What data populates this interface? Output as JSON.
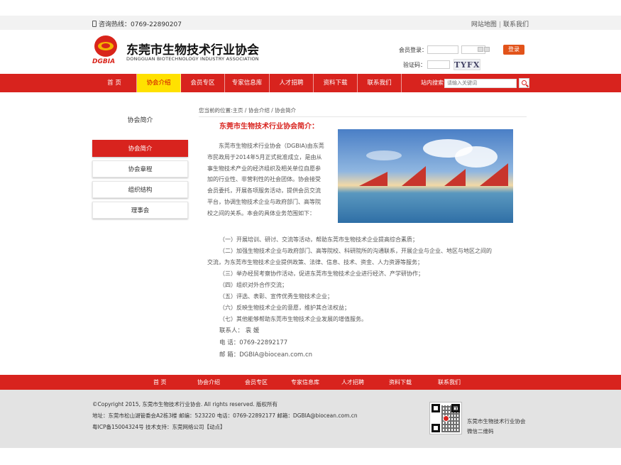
{
  "topbar": {
    "hotline": "咨询热线：0769-22890207",
    "links": [
      "网站地图",
      "联系我们"
    ]
  },
  "header": {
    "logo_mark": "DGBIA",
    "title": "东莞市生物技术行业协会",
    "subtitle": "DONGGUAN BIOTECHNOLOGY INDUSTRY ASSOCIATION"
  },
  "login": {
    "member_label": "会员登录：",
    "button": "登录",
    "code_label": "验证码：",
    "captcha": "TYFX"
  },
  "nav": {
    "items": [
      "首 页",
      "协会介绍",
      "会员专区",
      "专家信息库",
      "人才招聘",
      "资料下载",
      "联系我们"
    ],
    "search_label": "站内搜索:",
    "search_placeholder": "请输入关键词"
  },
  "sidebar": {
    "title": "协会简介",
    "items": [
      "协会简介",
      "协会章程",
      "组织结构",
      "理事会"
    ]
  },
  "breadcrumb": "您当前的位置:主页 / 协会介绍 / 协会简介",
  "content": {
    "title": "东莞市生物技术行业协会简介：",
    "intro_lines": [
      "　　东莞市生物技术行业协会（DGBIA)由东莞",
      "市民政局于2014年5月正式批准成立，是由从",
      "事生物技术产业的经济组织及相关单位自愿参",
      "加的行业性、非营利性的社会团体。协会接受",
      "会员委托，开展各项服务活动，提供会员交流",
      "平台，协调生物技术企业与政府部门、高等院",
      "校之间的关系。本会的具体业务范围如下："
    ],
    "duties": [
      "（一）开展培训、研讨、交流等活动，帮助东莞市生物技术企业提高综合素质；",
      "（二）加强生物技术企业与政府部门、高等院校、科研院所的沟通联系，开展企业与企业、地区与地区之间的",
      "交流，为东莞市生物技术企业提供政策、法律、信息、技术、资金、人力资源等服务；",
      "（三）举办经贸考察协作活动，促进东莞市生物技术企业进行经济、产学研协作；",
      "（四）组织对外合作交流；",
      "（五）评选、表彰、宣传优秀生物技术企业；",
      "（六）反映生物技术企业的意愿，维护其合法权益；",
      "（七）其他能够帮助东莞市生物技术企业发展的增值服务。"
    ],
    "contact": [
      "联系人：  袁  媛",
      "电  话：0769-22892177",
      "邮  箱：DGBIA@biocean.com.cn"
    ]
  },
  "footer_nav": [
    "首 页",
    "协会介绍",
    "会员专区",
    "专家信息库",
    "人才招聘",
    "资料下载",
    "联系我们"
  ],
  "footer": {
    "lines": [
      "©Copyright 2015, 东莞市生物技术行业协会. All rights reserved. 版权所有",
      "地址：东莞市松山湖管委会A2栋3楼 邮编：523220 电话：0769-22892177 邮箱：DGBIA@biocean.com.cn",
      "粤ICP备15004324号 技术支持：东莞网络公司【动点】"
    ],
    "qr_lines": [
      "东莞市生物技术行业协会",
      "微信二维码"
    ]
  },
  "colors": {
    "brand_red": "#d8231e",
    "nav_active": "#ffe100",
    "login_button": "#e2531a"
  }
}
